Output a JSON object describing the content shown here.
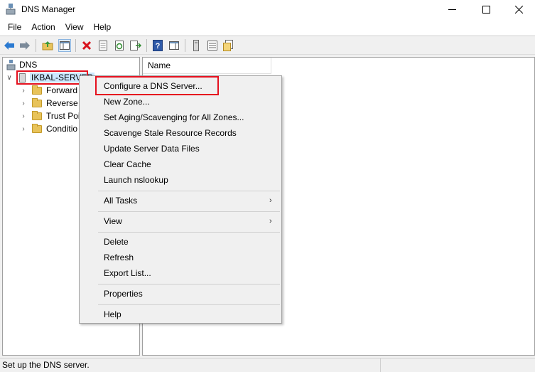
{
  "window": {
    "title": "DNS Manager",
    "icons": {
      "app": "dns-server-icon",
      "minimize": "minimize-icon",
      "maximize": "maximize-icon",
      "close": "close-icon"
    }
  },
  "menubar": {
    "items": [
      "File",
      "Action",
      "View",
      "Help"
    ]
  },
  "toolbar": {
    "icons": [
      "back-arrow-icon",
      "forward-arrow-icon",
      "up-folder-icon",
      "show-hide-tree-icon",
      "delete-icon",
      "properties-icon",
      "refresh-icon",
      "export-list-icon",
      "help-icon",
      "show-action-pane-icon",
      "server-icon",
      "records-icon",
      "zone-icon"
    ]
  },
  "tree": {
    "root": "DNS",
    "server": "IKBAL-SERVER",
    "children": [
      "Forward",
      "Reverse L",
      "Trust Poi",
      "Conditio"
    ]
  },
  "detail": {
    "column_header": "Name"
  },
  "context_menu": {
    "items": [
      "Configure a DNS Server...",
      "New Zone...",
      "Set Aging/Scavenging for All Zones...",
      "Scavenge Stale Resource Records",
      "Update Server Data Files",
      "Clear Cache",
      "Launch nslookup",
      "All Tasks",
      "View",
      "Delete",
      "Refresh",
      "Export List...",
      "Properties",
      "Help"
    ],
    "submenu_arrow": "›"
  },
  "statusbar": {
    "text": "Set up the DNS server."
  },
  "colors": {
    "highlight": "#e5101e",
    "selection": "#cce8ff",
    "folder": "#e8c35a"
  }
}
